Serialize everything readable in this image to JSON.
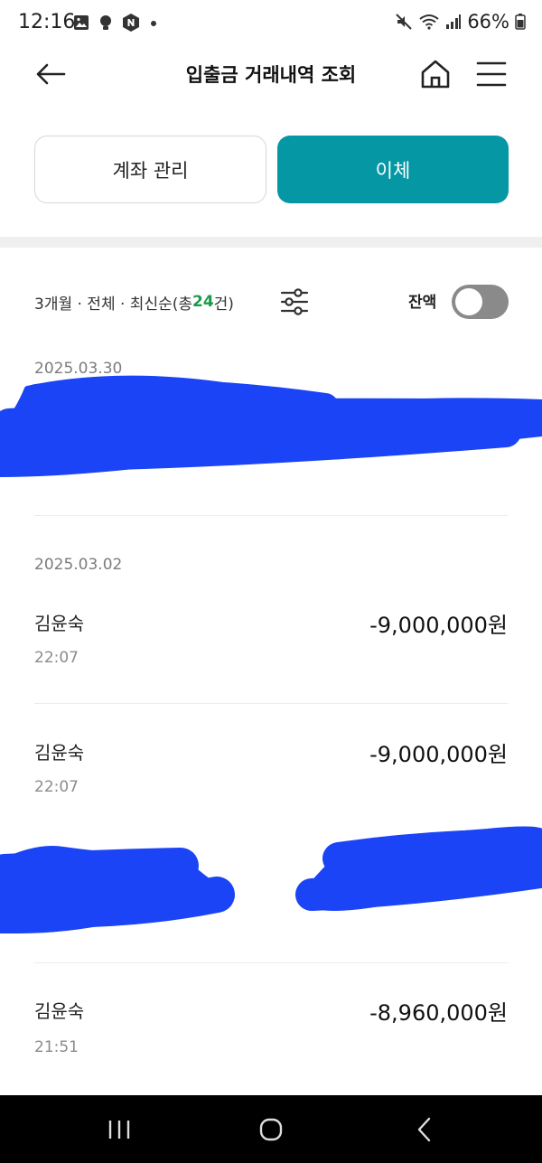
{
  "status_bar": {
    "time": "12:16",
    "battery": "66%",
    "left_icons": [
      "gallery-icon",
      "bulb-icon",
      "naver-icon",
      "dot-icon"
    ],
    "right_icons": [
      "mute-icon",
      "wifi-icon",
      "signal-icon",
      "battery-icon"
    ]
  },
  "header": {
    "title": "입출금 거래내역 조회",
    "icons": [
      "back-arrow-icon",
      "home-icon",
      "menu-icon"
    ]
  },
  "actions": {
    "account_manage": "계좌 관리",
    "transfer": "이체",
    "transfer_color": "#0697a5"
  },
  "filter": {
    "prefix": "3개월 · 전체 · 최신순(총 ",
    "count": "24",
    "suffix": "건)",
    "count_color": "#1b9a4b",
    "balance_label": "잔액",
    "balance_toggle_on": false
  },
  "groups": [
    {
      "date": "2025.03.30",
      "redacted": true
    },
    {
      "date": "2025.03.02",
      "transactions": [
        {
          "name": "김윤숙",
          "time": "22:07",
          "amount": "-9,000,000원"
        },
        {
          "name": "김윤숙",
          "time": "22:07",
          "amount": "-9,000,000원"
        },
        {
          "redacted": true
        },
        {
          "name": "김윤숙",
          "time": "21:51",
          "amount": "-8,960,000원"
        }
      ]
    }
  ],
  "redaction_color": "#1a44f5"
}
